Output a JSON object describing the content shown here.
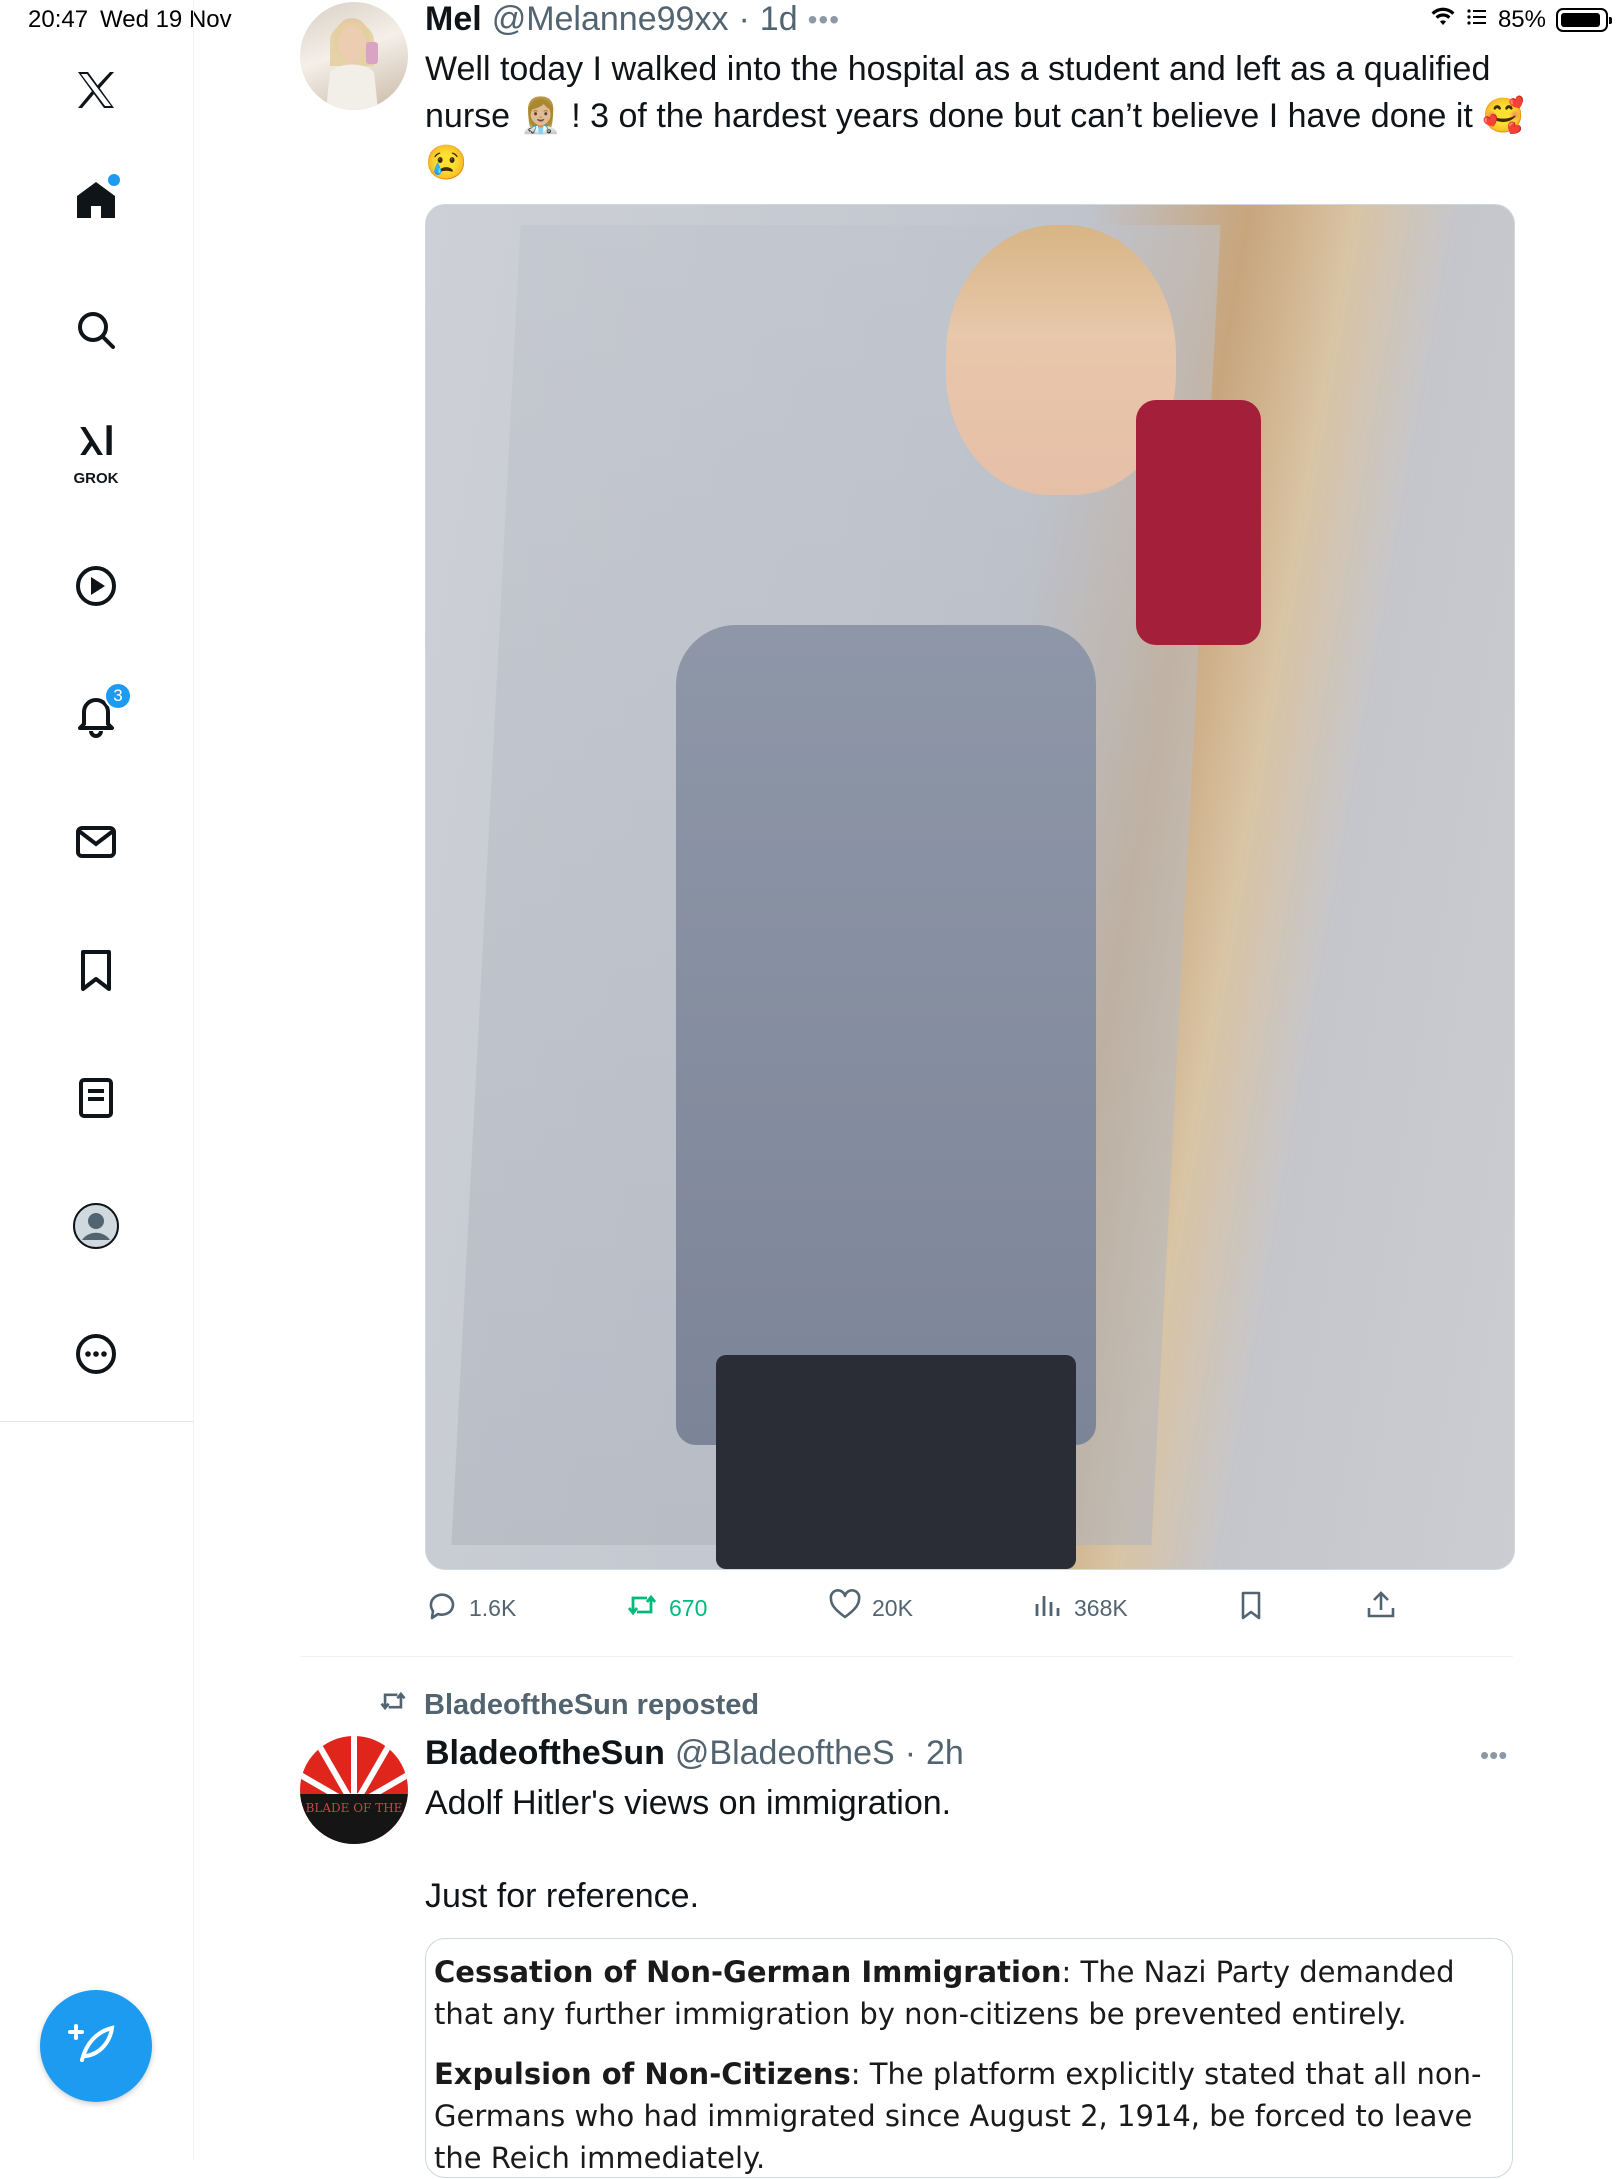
{
  "status_bar": {
    "time": "20:47",
    "date": "Wed 19 Nov",
    "battery": "85%",
    "battery_level": 0.85
  },
  "sidebar": {
    "logo": "x-logo-icon",
    "items": [
      {
        "icon": "home-icon",
        "has_dot": true
      },
      {
        "icon": "search-icon"
      },
      {
        "icon": "grok-icon",
        "label": "GROK"
      },
      {
        "icon": "video-play-icon"
      },
      {
        "icon": "bell-icon",
        "badge": "3"
      },
      {
        "icon": "mail-icon"
      },
      {
        "icon": "bookmark-icon"
      },
      {
        "icon": "lists-icon"
      },
      {
        "icon": "profile-icon"
      },
      {
        "icon": "more-icon"
      }
    ],
    "compose_icon": "compose-feather-icon",
    "accent_color": "#1d9bf0"
  },
  "tweet1": {
    "name": "Mel",
    "handle": "@Melanne99xx",
    "time": "1d",
    "text": "Well today I walked into the hospital as a student and left as a qualified nurse 👩🏼‍⚕️ ! 3 of the hardest years done but can’t believe I have done it 🥰😢",
    "image_alt": "mirror selfie in nurse uniform",
    "actions": {
      "replies": "1.6K",
      "reposts": "670",
      "likes": "20K",
      "views": "368K"
    },
    "repost_color": "#00ba7c"
  },
  "tweet2": {
    "reposted_by": "BladeoftheSun reposted",
    "name": "BladeoftheSun",
    "handle": "@BladeoftheS",
    "time": "2h",
    "text_line1": "Adolf Hitler's views on immigration.",
    "text_line2": "Just for reference.",
    "avatar_text": "BLADE OF THE",
    "quote": [
      {
        "title": "Cessation of Non-German Immigration",
        "body": ": The Nazi Party demanded that any further immigration by non-citizens be prevented entirely."
      },
      {
        "title": "Expulsion of Non-Citizens",
        "body": ": The platform explicitly stated that all non-Germans who had immigrated since August 2, 1914, be forced to leave the Reich immediately."
      }
    ]
  }
}
